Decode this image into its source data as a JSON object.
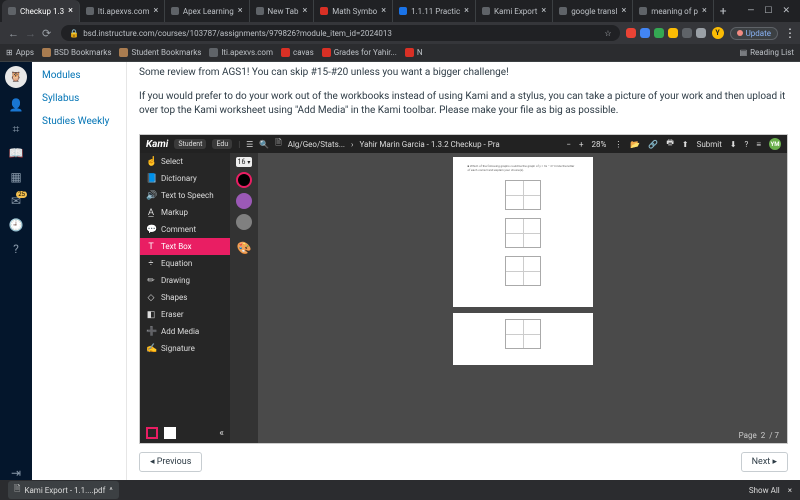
{
  "tabs": [
    {
      "label": "Checkup 1.3",
      "active": true
    },
    {
      "label": "lti.apexvs.com"
    },
    {
      "label": "Apex Learning"
    },
    {
      "label": "New Tab"
    },
    {
      "label": "Math Symbo"
    },
    {
      "label": "1.1.11 Practic"
    },
    {
      "label": "Kami Export"
    },
    {
      "label": "google transl"
    },
    {
      "label": "meaning of p"
    }
  ],
  "browser": {
    "url": "bsd.instructure.com/courses/103787/assignments/979826?module_item_id=2024013",
    "update": "Update"
  },
  "bookmarks": {
    "apps": "Apps",
    "items": [
      "BSD Bookmarks",
      "Student Bookmarks",
      "lti.apexvs.com",
      "cavas",
      "Grades for Yahir...",
      "N"
    ],
    "reading": "Reading List"
  },
  "course_nav": [
    "Modules",
    "Syllabus",
    "Studies Weekly"
  ],
  "intro": {
    "p1": "Some review from AGS1!  You can skip #15-#20 unless you want a bigger challenge!",
    "p2": "If you would prefer to do your work out of the workbooks instead of using Kami and a stylus, you can take a picture of your work and then upload it over top the Kami worksheet using \"Add Media\" in the Kami toolbar.  Please make your file as big as possible."
  },
  "kami": {
    "brand": "Kami",
    "pills": [
      "Student",
      "Edu"
    ],
    "crumb1": "Alg/Geo/Stats...",
    "crumb2": "Yahir Marin Garcia - 1.3.2 Checkup - Pra",
    "zoom": "28%",
    "submit": "Submit",
    "avatar": "YM",
    "tools": [
      "Select",
      "Dictionary",
      "Text to Speech",
      "Markup",
      "Comment",
      "Text Box",
      "Equation",
      "Drawing",
      "Shapes",
      "Eraser",
      "Add Media",
      "Signature"
    ],
    "active_tool": "Text Box",
    "font_size": "16",
    "page_label": "Page",
    "page_cur": "2",
    "page_total": "7"
  },
  "nav": {
    "prev": "Previous",
    "next": "Next"
  },
  "download": {
    "file": "Kami Export - 1.1....pdf",
    "showall": "Show All"
  },
  "icons": {
    "tools": [
      "☝",
      "📘",
      "🔊",
      "A̲",
      "💬",
      "T",
      "÷",
      "✏",
      "◇",
      "◧",
      "➕",
      "✍"
    ]
  },
  "colors": {
    "swatches": [
      "#000000",
      "#9b59b6",
      "#808080"
    ]
  }
}
